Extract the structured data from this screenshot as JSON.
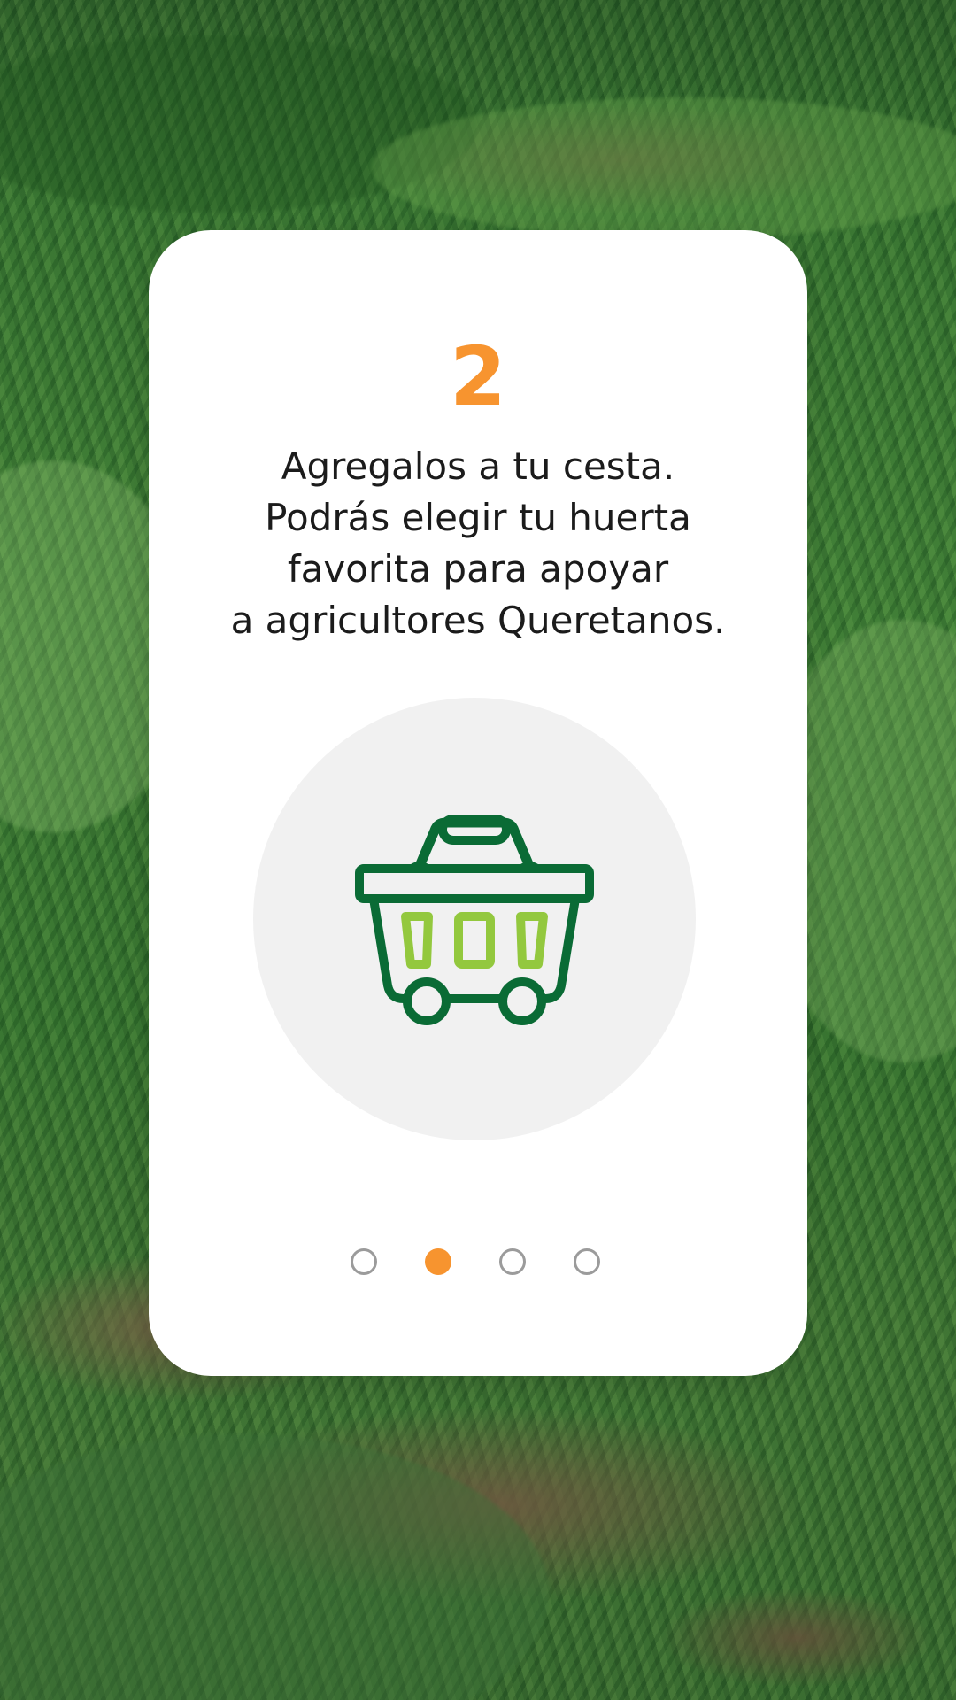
{
  "step": {
    "number": "2",
    "lines": [
      "Agregalos a tu cesta.",
      "Podrás elegir tu huerta",
      "favorita para apoyar",
      "a agricultores Queretanos."
    ]
  },
  "illustration": {
    "icon": "shopping-basket-icon",
    "colors": {
      "outline": "#0a6b35",
      "accent": "#93c83e",
      "circle": "#f1f1f1"
    }
  },
  "pagination": {
    "total": 4,
    "current": 2,
    "active_color": "#f7942f",
    "inactive_color": "#9b9b9b"
  },
  "background": {
    "description_color": "#1b1b1b",
    "accent_color": "#f7942f"
  }
}
